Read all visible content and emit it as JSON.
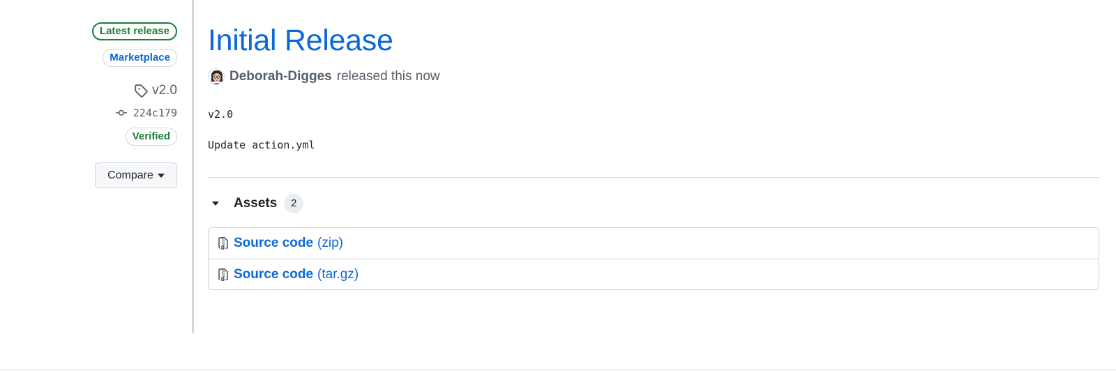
{
  "sidebar": {
    "latest_release_label": "Latest release",
    "marketplace_label": "Marketplace",
    "tag": {
      "icon": "tag-icon",
      "label": "v2.0"
    },
    "commit": {
      "icon": "git-commit-icon",
      "label": "224c179"
    },
    "verified_label": "Verified",
    "compare_label": "Compare"
  },
  "release": {
    "title": "Initial Release",
    "author": "Deborah-Digges",
    "released_text": "released this now",
    "body": [
      "v2.0",
      "Update action.yml"
    ]
  },
  "assets": {
    "heading": "Assets",
    "count": "2",
    "items": [
      {
        "icon": "file-zip-icon",
        "name": "Source code",
        "ext": "(zip)"
      },
      {
        "icon": "file-zip-icon",
        "name": "Source code",
        "ext": "(tar.gz)"
      }
    ]
  },
  "colors": {
    "link": "#0969da",
    "success": "#1a7f37",
    "border": "#d0d7de",
    "muted": "#57606a"
  }
}
